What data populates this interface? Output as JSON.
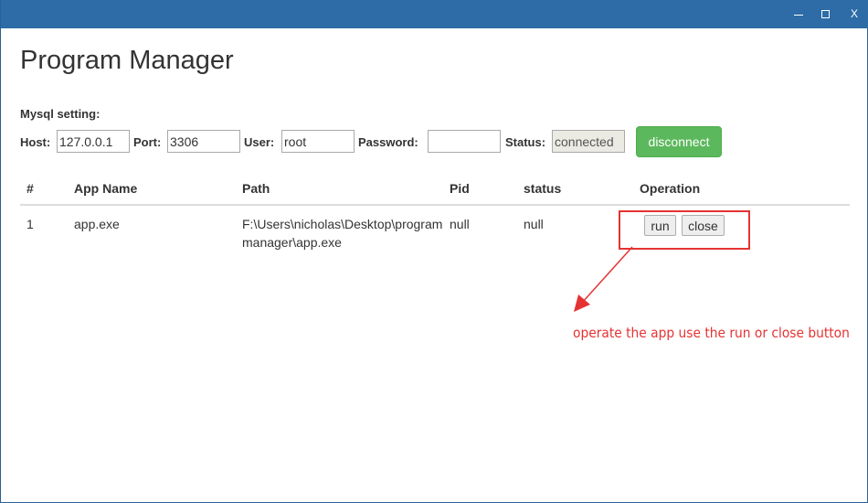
{
  "window": {
    "minimize_label": "",
    "maximize_label": "",
    "close_label": "X"
  },
  "page": {
    "title": "Program Manager"
  },
  "mysql": {
    "heading": "Mysql setting:",
    "host_label": "Host:",
    "host_value": "127.0.0.1",
    "port_label": "Port:",
    "port_value": "3306",
    "user_label": "User:",
    "user_value": "root",
    "password_label": "Password:",
    "password_value": "",
    "status_label": "Status:",
    "status_value": "connected",
    "disconnect_label": "disconnect"
  },
  "table": {
    "columns": [
      "#",
      "App Name",
      "Path",
      "Pid",
      "status",
      "Operation"
    ],
    "rows": [
      {
        "index": "1",
        "app_name": "app.exe",
        "path": "F:\\Users\\nicholas\\Desktop\\program manager\\app.exe",
        "pid": "null",
        "status": "null",
        "run_label": "run",
        "close_label": "close"
      }
    ]
  },
  "annotation": {
    "text": "operate the app use the run or close button",
    "color": "#e53333"
  },
  "colors": {
    "titlebar": "#2d6ca7",
    "success": "#5cb85c"
  }
}
